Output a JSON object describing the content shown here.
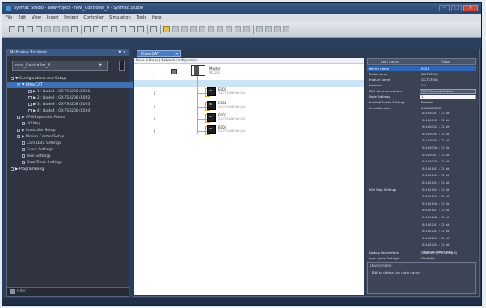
{
  "window": {
    "title": "Sysmac Studio - NewProject - new_Controller_0 - Sysmac Studio",
    "minimize": "–",
    "maximize": "□",
    "close": "✕"
  },
  "menu": [
    "File",
    "Edit",
    "View",
    "Insert",
    "Project",
    "Controller",
    "Simulation",
    "Tools",
    "Help"
  ],
  "sidebar": {
    "title": "Multiview Explorer",
    "pin": "▼ ✕",
    "controller_select": "new_Controller_0",
    "controller_arrow": "▼",
    "items": [
      {
        "label": "▼ Configurations and Setup",
        "indent": 4,
        "style": "group"
      },
      {
        "label": "▼ EtherCAT",
        "indent": 12,
        "style": "sel"
      },
      {
        "label": "▶ 1 : Node1 : GX-TS3208 (E001)",
        "indent": 26,
        "style": ""
      },
      {
        "label": "▶ 2 : Node2 : GX-TS3208 (E002)",
        "indent": 26,
        "style": ""
      },
      {
        "label": "▶ 3 : Node3 : GX-TS3208 (E003)",
        "indent": 26,
        "style": ""
      },
      {
        "label": "▶ 4 : Node4 : GX-TS3208 (E004)",
        "indent": 26,
        "style": ""
      },
      {
        "label": "▶ CPU/Expansion Racks",
        "indent": 12,
        "style": ""
      },
      {
        "label": "I/O Map",
        "indent": 18,
        "style": ""
      },
      {
        "label": "▶ Controller Setup",
        "indent": 12,
        "style": ""
      },
      {
        "label": "▶ Motion Control Setup",
        "indent": 12,
        "style": ""
      },
      {
        "label": "Cam Data Settings",
        "indent": 18,
        "style": ""
      },
      {
        "label": "Event Settings",
        "indent": 18,
        "style": ""
      },
      {
        "label": "Task Settings",
        "indent": 18,
        "style": ""
      },
      {
        "label": "Data Trace Settings",
        "indent": 18,
        "style": ""
      },
      {
        "label": "▶ Programming",
        "indent": 4,
        "style": "group"
      }
    ],
    "filter": "Filter"
  },
  "editor": {
    "tab_label": "EtherCAT",
    "tab_close": "✕",
    "canvas_toolbar": "Node Address | Network configuration",
    "master": {
      "label": "Master",
      "model": "NX1P2"
    },
    "slaves": [
      {
        "num": "1",
        "name": "E001",
        "model": "GX-TS3208 Rev:2.0"
      },
      {
        "num": "2",
        "name": "E002",
        "model": "GX-TS3208 Rev:2.0"
      },
      {
        "num": "3",
        "name": "E003",
        "model": "GX-TS3208 Rev:2.0"
      },
      {
        "num": "4",
        "name": "E004",
        "model": "GX-TS3208 Rev:2.0"
      }
    ]
  },
  "props": {
    "col_item": "Item name",
    "col_value": "Value",
    "rows": [
      {
        "name": "Device name",
        "value": "E001",
        "sel": true
      },
      {
        "name": "Model name",
        "value": "GX-TS3208"
      },
      {
        "name": "Product name",
        "value": "GX-TS3208"
      },
      {
        "name": "Revision",
        "value": "2.0"
      },
      {
        "name": "PDO Communications",
        "value": "PDO Communications"
      },
      {
        "name": "Node Address",
        "value": "1"
      },
      {
        "name": "Enable/Disable Settings",
        "value": "Enabled"
      },
      {
        "name": "Serial Number",
        "value": "0x00000000"
      }
    ],
    "pdo_label": "PDO Map Settings",
    "list": [
      "0x1A00:01 : 32 bit",
      "0x1A00:02 : 32 bit",
      "0x1A00:03 : 32 bit",
      "0x1A00:04 : 32 bit",
      "0x1A00:05 : 32 bit",
      "0x1A00:06 : 32 bit",
      "0x1A00:07 : 32 bit",
      "0x1A00:08 : 32 bit",
      "0x1A01:01 : 32 bit",
      "0x1A01:02 : 32 bit",
      "0x1A01:03 : 32 bit",
      "0x1A01:04 : 32 bit",
      "0x1A01:05 : 32 bit",
      "0x1A01:06 : 32 bit",
      "0x1A01:07 : 32 bit",
      "0x1A01:08 : 32 bit",
      "0x1A02:01 : 32 bit",
      "0x1A02:02 : 32 bit",
      "0x1A02:03 : 32 bit",
      "0x1A02:04 : 32 bit",
      "Total PDO Map Count"
    ],
    "bottom_rows": [
      {
        "name": "Backup Parameters",
        "value": "Disabled (TPDO Disp.S)"
      },
      {
        "name": "Sync Cycle Settings",
        "value": "Disabled"
      }
    ],
    "desc_title": "Device name",
    "desc_text": "Edit or delete the node name."
  },
  "colors": {
    "accent": "#3d6fb4",
    "port": "#e8a030",
    "frame": "#2a3f5d"
  }
}
